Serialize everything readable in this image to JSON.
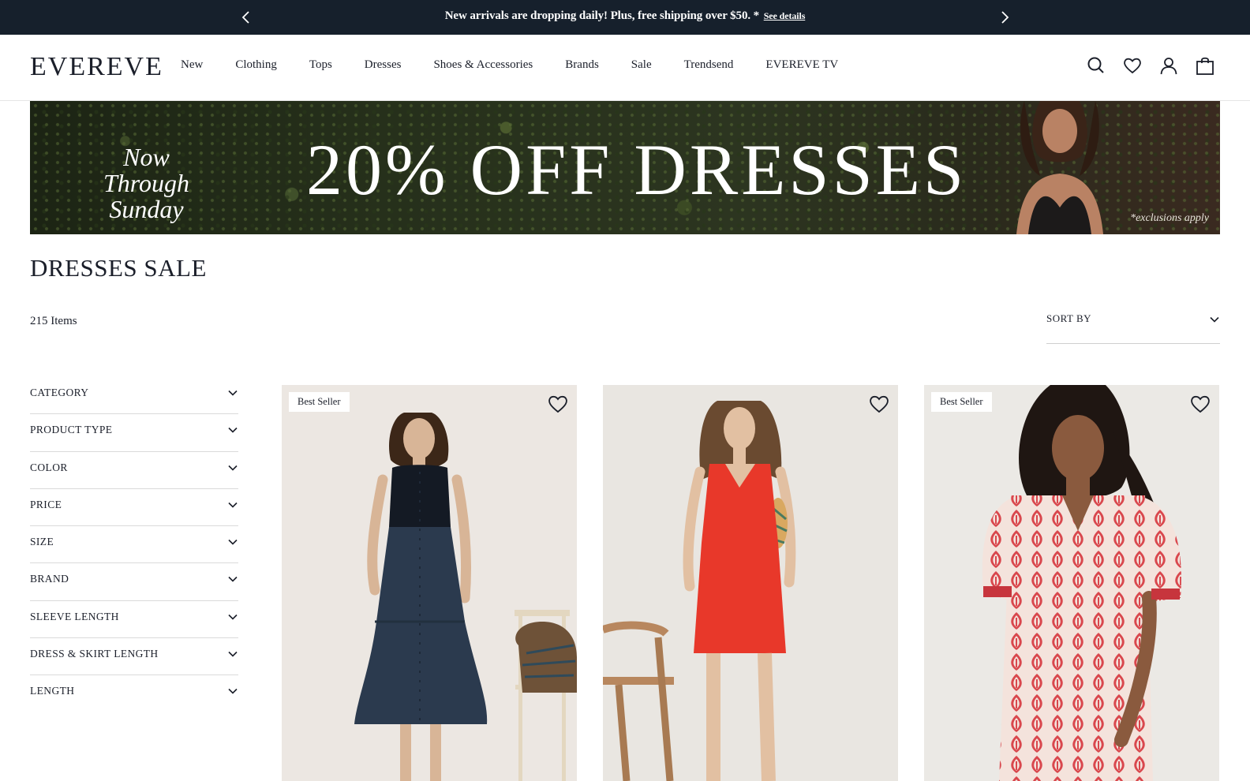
{
  "announcement": {
    "message": "New arrivals are dropping daily! Plus, free shipping over $50. *",
    "link": "See details"
  },
  "header": {
    "logo": "EVEREVE",
    "nav": [
      "New",
      "Clothing",
      "Tops",
      "Dresses",
      "Shoes & Accessories",
      "Brands",
      "Sale",
      "Trendsend",
      "EVEREVE TV"
    ],
    "icons": [
      "search-icon",
      "heart-icon",
      "account-icon",
      "bag-icon"
    ]
  },
  "banner": {
    "tagline_line1": "Now Through",
    "tagline_line2": "Sunday",
    "headline": "20% OFF DRESSES",
    "note": "*exclusions apply"
  },
  "page": {
    "title": "DRESSES SALE",
    "count": "215 Items",
    "sort_label": "SORT BY"
  },
  "filters": [
    "CATEGORY",
    "PRODUCT TYPE",
    "COLOR",
    "PRICE",
    "SIZE",
    "BRAND",
    "SLEEVE LENGTH",
    "DRESS & SKIRT LENGTH",
    "LENGTH"
  ],
  "products": [
    {
      "badge": "Best Seller",
      "dress_color": "#2b3a4e"
    },
    {
      "badge": "",
      "dress_color": "#e8382a"
    },
    {
      "badge": "Best Seller",
      "dress_color": "#d9474d"
    }
  ],
  "colors": {
    "announcement_bg": "#16202c",
    "text": "#1b1f2a"
  }
}
